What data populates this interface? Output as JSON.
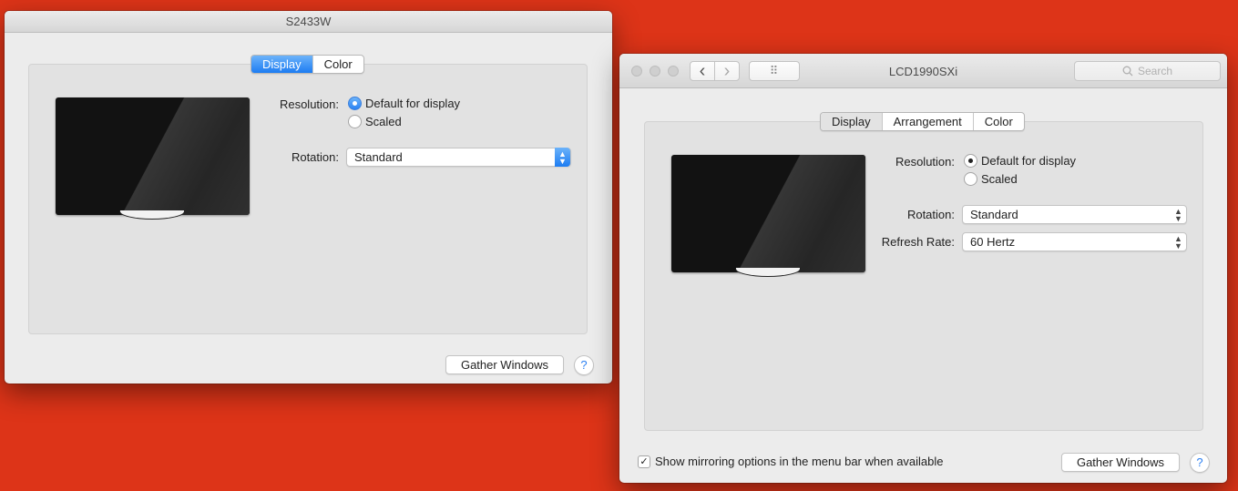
{
  "colors": {
    "desktop": "#dd3418",
    "accent": "#1d7cf2",
    "window_bg": "#ececec"
  },
  "left_window": {
    "title": "S2433W",
    "tabs": [
      {
        "label": "Display",
        "active": true
      },
      {
        "label": "Color",
        "active": false
      }
    ],
    "resolution_label": "Resolution:",
    "resolution_options": [
      {
        "label": "Default for display",
        "selected": true
      },
      {
        "label": "Scaled",
        "selected": false
      }
    ],
    "rotation_label": "Rotation:",
    "rotation_value": "Standard",
    "gather_button": "Gather Windows",
    "help_label": "?"
  },
  "right_window": {
    "title": "LCD1990SXi",
    "search_placeholder": "Search",
    "back_icon": "‹",
    "forward_icon": "›",
    "grid_icon": "⠿",
    "tabs": [
      {
        "label": "Display",
        "active": true
      },
      {
        "label": "Arrangement",
        "active": false
      },
      {
        "label": "Color",
        "active": false
      }
    ],
    "resolution_label": "Resolution:",
    "resolution_options": [
      {
        "label": "Default for display",
        "selected": true
      },
      {
        "label": "Scaled",
        "selected": false
      }
    ],
    "rotation_label": "Rotation:",
    "rotation_value": "Standard",
    "refresh_label": "Refresh Rate:",
    "refresh_value": "60 Hertz",
    "mirroring_checkbox": {
      "label": "Show mirroring options in the menu bar when available",
      "checked": true
    },
    "gather_button": "Gather Windows",
    "help_label": "?"
  }
}
